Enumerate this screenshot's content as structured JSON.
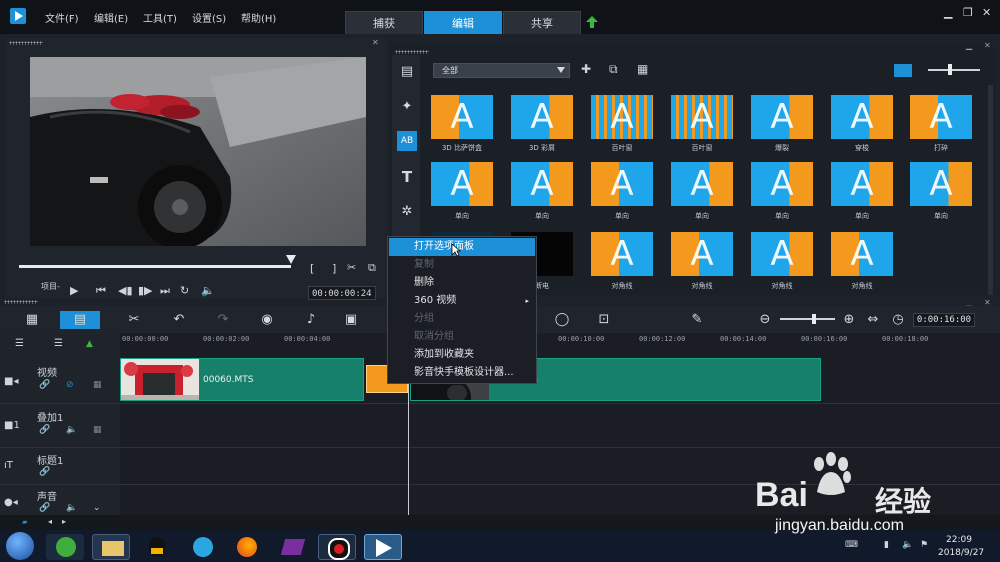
{
  "menu": [
    "文件(F)",
    "编辑(E)",
    "工具(T)",
    "设置(S)",
    "帮助(H)"
  ],
  "tabs": [
    {
      "label": "捕获",
      "active": false
    },
    {
      "label": "编辑",
      "active": true
    },
    {
      "label": "共享",
      "active": false
    }
  ],
  "player": {
    "project_label": "项目-",
    "timecode": "00:00:00:24",
    "bracket_left": "[",
    "bracket_right": "]"
  },
  "library": {
    "filter": "全部",
    "transitions": [
      {
        "label": "3D 比萨饼盒"
      },
      {
        "label": "3D 彩屑"
      },
      {
        "label": "百叶窗"
      },
      {
        "label": "百叶窗"
      },
      {
        "label": "爆裂"
      },
      {
        "label": "穿梭"
      },
      {
        "label": "打碎"
      },
      {
        "label": "单向"
      },
      {
        "label": "单向"
      },
      {
        "label": "单向"
      },
      {
        "label": "单向"
      },
      {
        "label": "单向"
      },
      {
        "label": "单向"
      },
      {
        "label": "单向"
      },
      {
        "label": "到黑色"
      },
      {
        "label": "断电"
      },
      {
        "label": "对角线"
      },
      {
        "label": "对角线"
      },
      {
        "label": "对角线"
      },
      {
        "label": "对角线"
      }
    ]
  },
  "context_menu": [
    {
      "label": "打开选项面板",
      "enabled": true,
      "highlight": true
    },
    {
      "label": "复制",
      "enabled": false
    },
    {
      "label": "删除",
      "enabled": true
    },
    {
      "label": "360 视频",
      "enabled": true,
      "submenu": true
    },
    {
      "label": "分组",
      "enabled": false
    },
    {
      "label": "取消分组",
      "enabled": false
    },
    {
      "label": "添加到收藏夹",
      "enabled": true
    },
    {
      "label": "影音快手模板设计器...",
      "enabled": true
    }
  ],
  "timeline": {
    "timecode": "0:00:16:00",
    "ruler": [
      "00:00:00:00",
      "00:00:02:00",
      "00:00:04:00",
      "00:00:10:00",
      "00:00:12:00",
      "00:00:14:00",
      "00:00:16:00",
      "00:00:18:00"
    ],
    "tracks": [
      {
        "name": "视频"
      },
      {
        "name": "叠加1"
      },
      {
        "name": "标题1"
      },
      {
        "name": "声音"
      }
    ],
    "clips": [
      {
        "label": "00060.MTS"
      },
      {
        "label": "S"
      }
    ]
  },
  "taskbar": {
    "time": "22:09",
    "date": "2018/9/27"
  },
  "watermark": {
    "brand": "Bai",
    "brand2": "经验",
    "url": "jingyan.baidu.com"
  },
  "colors": {
    "accent": "#1e90d8",
    "clip": "#17806b",
    "transition_orange": "#f39a1e",
    "transition_blue": "#1fa6ea"
  }
}
